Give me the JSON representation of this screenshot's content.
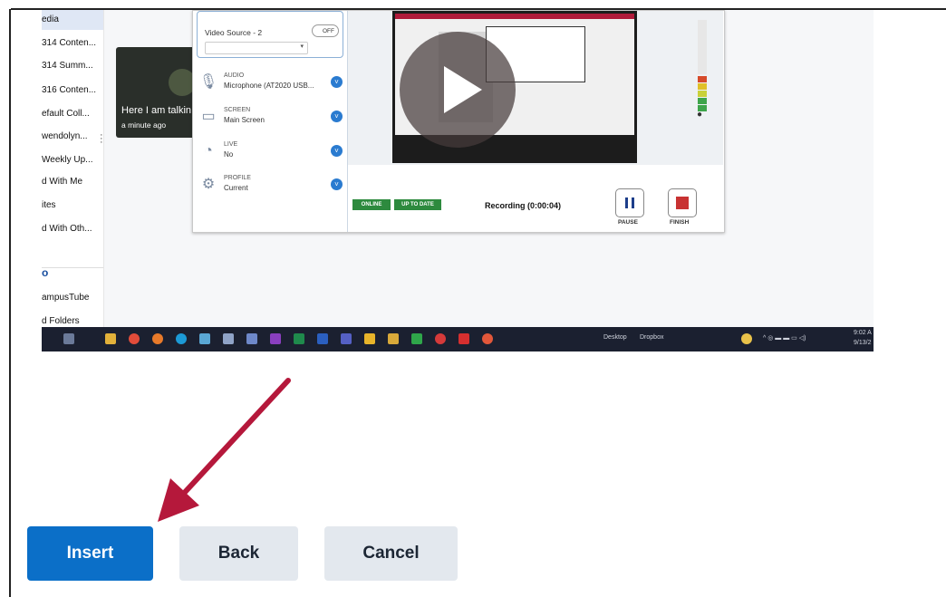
{
  "screenshot": {
    "left_list": {
      "items": [
        "edia",
        "314 Conten...",
        "314 Summ...",
        "316 Conten...",
        "efault Coll...",
        "wendolyn...",
        "Weekly Up...",
        "d With Me",
        "ites",
        "d With Oth..."
      ],
      "section_heading": "o",
      "lower_items": [
        "ampusTube",
        "d Folders"
      ]
    },
    "video_card": {
      "title": "Here I am talkin",
      "time": "a minute ago"
    },
    "recorder": {
      "video_source_label": "Video Source - 2",
      "toggle_label": "OFF",
      "rows": [
        {
          "label": "AUDIO",
          "value": "Microphone (AT2020 USB..."
        },
        {
          "label": "SCREEN",
          "value": "Main Screen"
        },
        {
          "label": "LIVE",
          "value": "No"
        },
        {
          "label": "PROFILE",
          "value": "Current"
        }
      ],
      "status_online": "ONLINE",
      "status_uptodate": "UP TO DATE",
      "recording_text": "Recording (0:00:04)",
      "pause_label": "PAUSE",
      "finish_label": "FINISH"
    },
    "taskbar": {
      "desktop_label": "Desktop",
      "dropbox_label": "Dropbox",
      "clock_time": "9:02 A",
      "clock_date": "9/13/2"
    }
  },
  "actions": {
    "insert_label": "Insert",
    "back_label": "Back",
    "cancel_label": "Cancel"
  },
  "colors": {
    "primary": "#0b6fc8",
    "secondary": "#e3e8ee",
    "arrow": "#b5183b"
  }
}
